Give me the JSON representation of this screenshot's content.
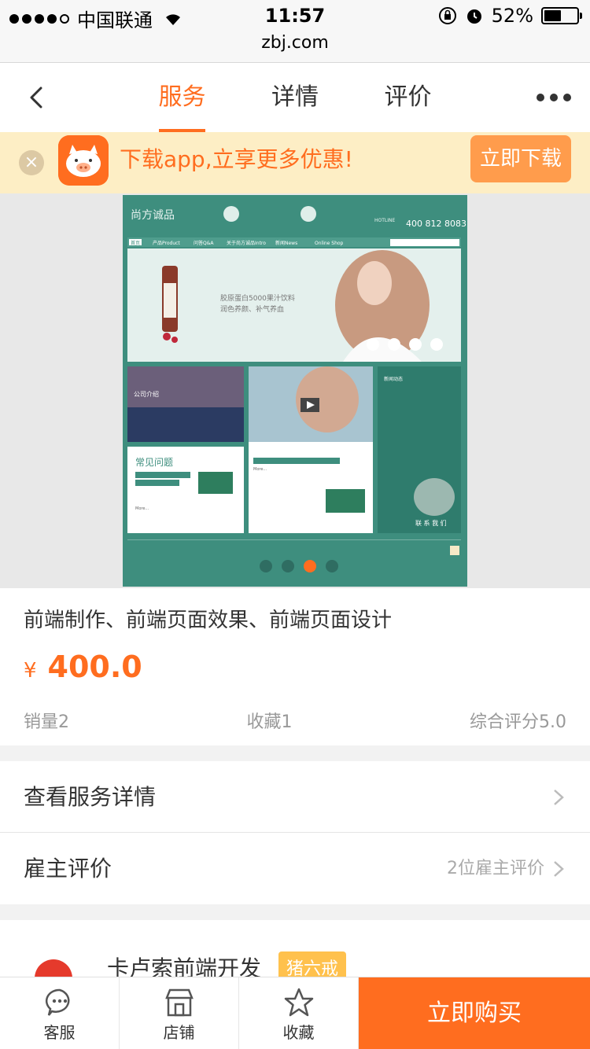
{
  "status_bar": {
    "carrier": "中国联通",
    "time": "11:57",
    "battery": "52%",
    "battery_level": 0.52,
    "url": "zbj.com"
  },
  "nav": {
    "tabs": [
      "服务",
      "详情",
      "评价"
    ],
    "active_tab": 0
  },
  "banner": {
    "text": "下载app,立享更多优惠!",
    "button": "立即下载"
  },
  "gallery": {
    "slide_count": 4,
    "active_slide": 2,
    "preview": {
      "brand": "尚方诚品",
      "hotline_label": "HOTLINE",
      "hotline": "400 812 8083",
      "menu": [
        "首页",
        "产品Product",
        "问答Q&A",
        "关于尚方诚品Intro",
        "新闻News",
        "Online Shop"
      ],
      "hero_line1": "胶原蛋白5000果汁饮料",
      "hero_line2": "润色养颜、补气养血",
      "company_label": "公司介绍",
      "faq_label": "常见问题",
      "news_label": "新闻动态",
      "contact_label": "联 系 我 们",
      "more": "More..."
    }
  },
  "product": {
    "title": "前端制作、前端页面效果、前端页面设计",
    "currency": "¥",
    "price": "400.0",
    "sales": "销量2",
    "favorites": "收藏1",
    "rating": "综合评分5.0"
  },
  "rows": {
    "details": "查看服务详情",
    "reviews": "雇主评价",
    "reviews_count": "2位雇主评价"
  },
  "store": {
    "name": "卡卢索前端开发",
    "badge": "猪六戒"
  },
  "bottom_bar": {
    "service": "客服",
    "shop": "店铺",
    "favorite": "收藏",
    "buy": "立即购买"
  },
  "colors": {
    "accent": "#ff6d1f",
    "banner_bg": "#fdeec5",
    "preview_green": "#3e8e7e"
  }
}
